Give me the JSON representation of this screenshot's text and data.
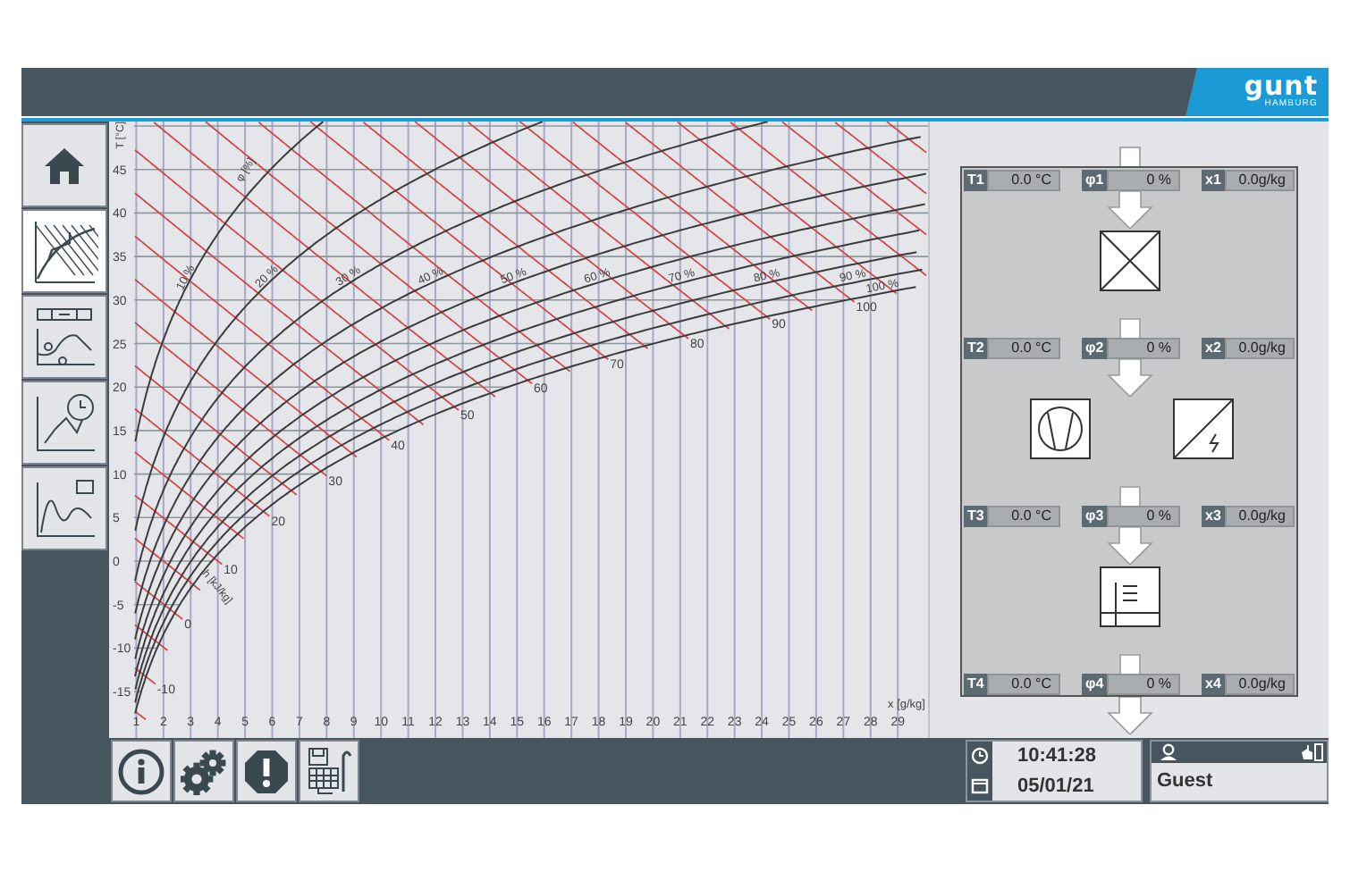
{
  "header": {
    "logo": "gunt",
    "logo_sub": "HAMBURG"
  },
  "sidebar": {
    "items": [
      {
        "kind": "home",
        "selected": false
      },
      {
        "kind": "hx_diagram",
        "selected": true
      },
      {
        "kind": "process",
        "selected": false
      },
      {
        "kind": "time_chart",
        "selected": false
      },
      {
        "kind": "trend",
        "selected": false
      }
    ]
  },
  "chart": {
    "y_label": "T [°C]",
    "x_label": "x [g/kg]",
    "phi_label": "φ [%]",
    "h_label": "h [kJ/kg]",
    "y_ticks": [
      "45",
      "40",
      "35",
      "30",
      "25",
      "20",
      "15",
      "10",
      "5",
      "0",
      "-5",
      "-10",
      "-15"
    ],
    "x_ticks": [
      "1",
      "2",
      "3",
      "4",
      "5",
      "6",
      "7",
      "8",
      "9",
      "10",
      "11",
      "12",
      "13",
      "14",
      "15",
      "16",
      "17",
      "18",
      "19",
      "20",
      "21",
      "22",
      "23",
      "24",
      "25",
      "26",
      "27",
      "28",
      "29"
    ],
    "phi_curves": [
      "10 %",
      "20 %",
      "30 %",
      "40 %",
      "50 %",
      "60 %",
      "70 %",
      "80 %",
      "90 %",
      "100 %"
    ],
    "h_lines": [
      "-10",
      "0",
      "10",
      "20",
      "30",
      "40",
      "50",
      "60",
      "70",
      "80",
      "90",
      "100"
    ]
  },
  "process": {
    "stations": [
      {
        "t_label": "T1",
        "t_value": "0.0 °C",
        "phi_label": "φ1",
        "phi_value": "0 %",
        "x_label": "x1",
        "x_value": "0.0g/kg"
      },
      {
        "t_label": "T2",
        "t_value": "0.0 °C",
        "phi_label": "φ2",
        "phi_value": "0 %",
        "x_label": "x2",
        "x_value": "0.0g/kg"
      },
      {
        "t_label": "T3",
        "t_value": "0.0 °C",
        "phi_label": "φ3",
        "phi_value": "0 %",
        "x_label": "x3",
        "x_value": "0.0g/kg"
      },
      {
        "t_label": "T4",
        "t_value": "0.0 °C",
        "phi_label": "φ4",
        "phi_value": "0 %",
        "x_label": "x4",
        "x_value": "0.0g/kg"
      }
    ],
    "units": [
      [
        {
          "kind": "filter"
        }
      ],
      [
        {
          "kind": "fan"
        },
        {
          "kind": "heater"
        }
      ],
      [
        {
          "kind": "humidifier"
        }
      ]
    ]
  },
  "toolbar": {
    "buttons": [
      {
        "kind": "info"
      },
      {
        "kind": "settings"
      },
      {
        "kind": "alert"
      },
      {
        "kind": "export"
      }
    ]
  },
  "clock": {
    "time": "10:41:28",
    "date": "05/01/21"
  },
  "user": {
    "name": "Guest"
  }
}
